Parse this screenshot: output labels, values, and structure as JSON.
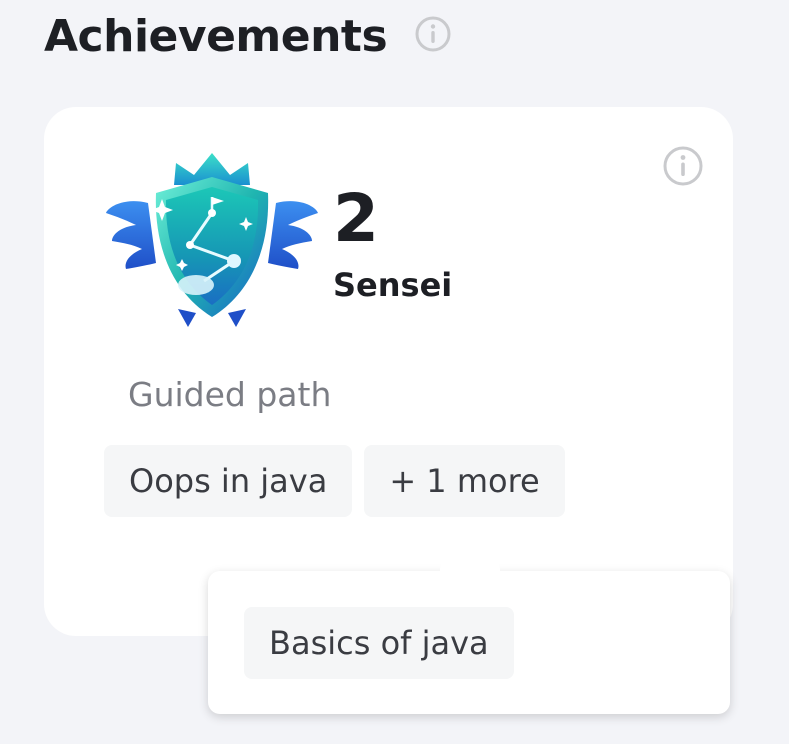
{
  "section": {
    "title": "Achievements",
    "info_icon": "info-icon"
  },
  "card": {
    "info_icon": "info-icon",
    "badge_icon": "shield-badge-icon",
    "rank_number": "2",
    "rank_name": "Sensei",
    "path_label": "Guided path",
    "chips": [
      {
        "label": "Oops in java"
      },
      {
        "label": "+ 1 more"
      }
    ]
  },
  "popover": {
    "chips": [
      {
        "label": "Basics of java"
      }
    ]
  },
  "colors": {
    "background": "#f3f4f8",
    "card": "#ffffff",
    "chip": "#f5f6f7",
    "text_primary": "#1d1f24",
    "text_secondary": "#7b7d84",
    "badge_teal": "#1fb5b0",
    "badge_blue": "#2f6fe4"
  }
}
